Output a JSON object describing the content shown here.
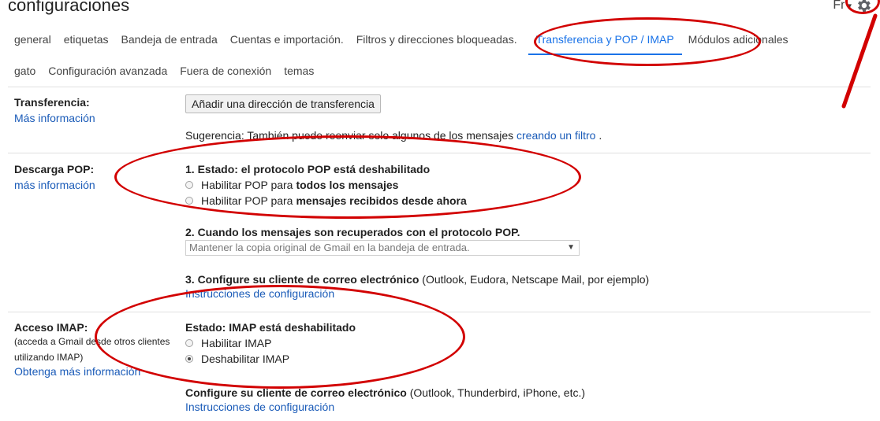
{
  "page": {
    "title": "configuraciones",
    "user_initial": "Fr"
  },
  "tabs_row1": [
    "general",
    "etiquetas",
    "Bandeja de entrada",
    "Cuentas e importación.",
    "Filtros y direcciones bloqueadas.",
    "Transferencia y POP / IMAP",
    "Módulos adicionales"
  ],
  "tabs_row2": [
    "gato",
    "Configuración avanzada",
    "Fuera de conexión",
    "temas"
  ],
  "active_tab": "Transferencia y POP / IMAP",
  "forwarding": {
    "label": "Transferencia:",
    "link": "Más información",
    "button": "Añadir una dirección de transferencia",
    "tip_prefix": "Sugerencia: También puede reenviar solo algunos de los mensajes",
    "tip_link": "creando un filtro",
    "tip_suffix": "."
  },
  "pop": {
    "label": "Descarga POP:",
    "link": "más información",
    "status": "1. Estado: el protocolo POP está deshabilitado",
    "opt1_prefix": "Habilitar POP para ",
    "opt1_bold": "todos los mensajes",
    "opt2_prefix": "Habilitar POP para ",
    "opt2_bold": "mensajes recibidos desde ahora",
    "step2": "2. Cuando los mensajes son recuperados con el protocolo POP.",
    "select_value": "Mantener la copia original de Gmail en la bandeja de entrada.",
    "step3_bold": "3. Configure su cliente de correo electrónico",
    "step3_rest": " (Outlook, Eudora, Netscape Mail, por ejemplo)",
    "step3_link": "Instrucciones de configuración"
  },
  "imap": {
    "label": "Acceso IMAP:",
    "sub1": "(acceda a Gmail desde otros clientes",
    "sub2": "utilizando IMAP)",
    "link": "Obtenga más información",
    "status": "Estado: IMAP está deshabilitado",
    "opt1": "Habilitar IMAP",
    "opt2": "Deshabilitar IMAP",
    "configure_bold": "Configure su cliente de correo electrónico",
    "configure_rest": " (Outlook, Thunderbird, iPhone, etc.)",
    "configure_link": "Instrucciones de configuración"
  },
  "colors": {
    "accent": "#1a73e8",
    "link": "#1a5bb8",
    "annotation": "#d20000"
  }
}
